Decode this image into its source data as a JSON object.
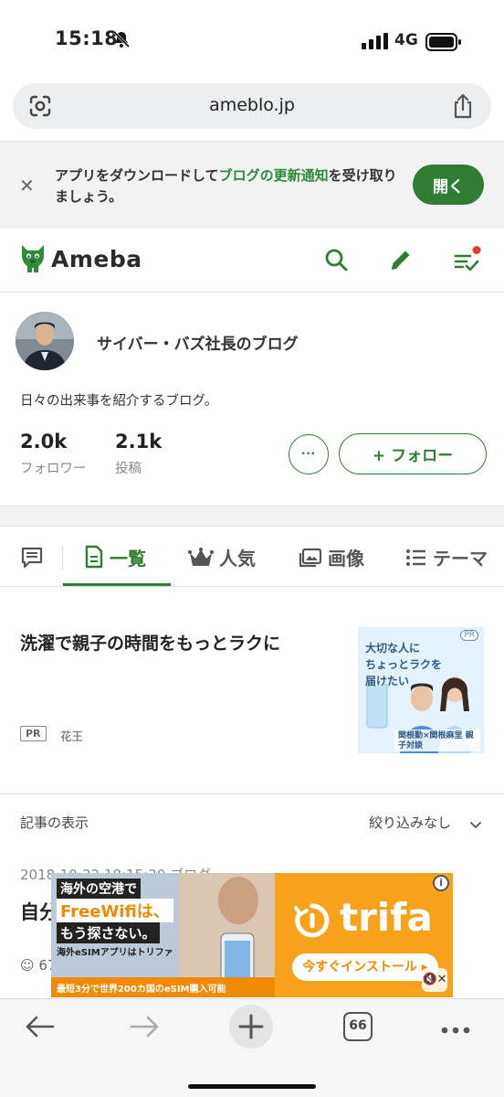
{
  "status_bar": {
    "time": "15:18",
    "network": "4G"
  },
  "browser": {
    "url": "ameblo.jp",
    "tab_count": "66"
  },
  "app_banner": {
    "message_part1": "アプリをダウンロードして",
    "message_highlight": "ブログの更新通知",
    "message_part2": "を受け取りましょう。",
    "open_label": "開く"
  },
  "header": {
    "logo_text": "Ameba"
  },
  "profile": {
    "blog_name": "サイバー・バズ社長のブログ",
    "description": "日々の出来事を紹介するブログ。",
    "followers_count": "2.0k",
    "followers_label": "フォロワー",
    "posts_count": "2.1k",
    "posts_label": "投稿",
    "more_label": "···",
    "follow_label": "+ フォロー"
  },
  "tabs": [
    {
      "label": "一覧",
      "active": true
    },
    {
      "label": "人気",
      "active": false
    },
    {
      "label": "画像",
      "active": false
    },
    {
      "label": "テーマ",
      "active": false
    }
  ],
  "pr_article": {
    "title": "洗濯で親子の時間をもっとラクに",
    "badge": "PR",
    "sponsor": "花王",
    "thumb_text1": "大切な人に",
    "thumb_text2": "ちょっとラクを",
    "thumb_text3": "届けたい",
    "thumb_caption": "関根勤×関根麻里 親子対談",
    "thumb_badge": "PR"
  },
  "filter": {
    "label": "記事の表示",
    "value": "絞り込みなし"
  },
  "article": {
    "date": "2018-10-22 18:15:20 ブログ",
    "title": "自分",
    "meta": "☺ 67"
  },
  "overlay_ad": {
    "line1": "海外の空港で",
    "line2": "FreeWifiは、",
    "line3": "もう探さない。",
    "brand_small": "海外eSIMアプリはトリファ",
    "strip": "最短3分で世界200カ国のeSIM購入可能",
    "brand": "trifa",
    "cta": "今すぐインストール ▸",
    "info": "i",
    "mute": "🔇✕"
  },
  "colors": {
    "accent": "#2e7d32",
    "ad_orange": "#f6a21a"
  }
}
